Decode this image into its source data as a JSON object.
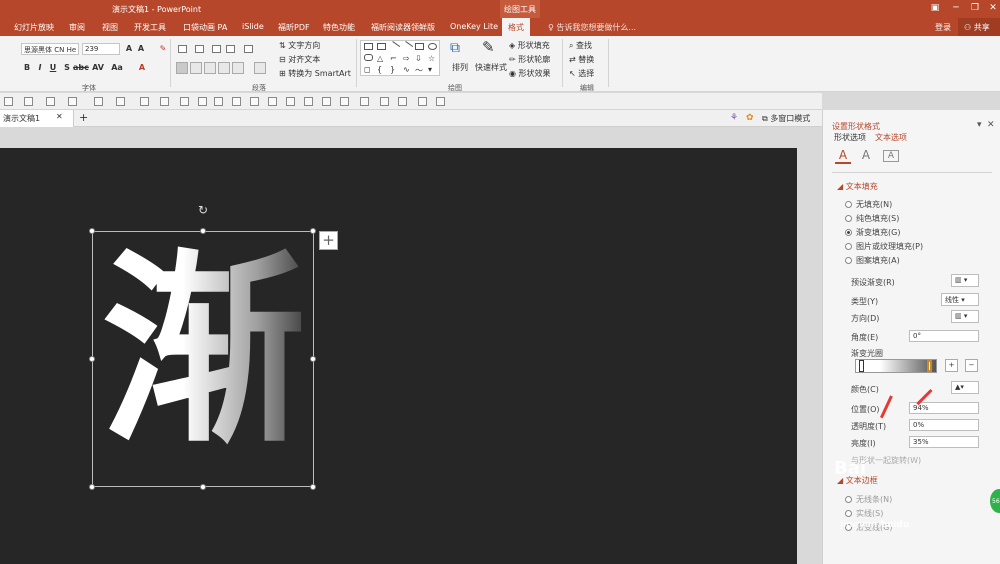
{
  "window": {
    "title": "演示文稿1 - PowerPoint",
    "context_tab": "绘图工具"
  },
  "tabs": [
    {
      "label": "幻灯片放映"
    },
    {
      "label": "审阅"
    },
    {
      "label": "视图"
    },
    {
      "label": "开发工具"
    },
    {
      "label": "口袋动画 PA"
    },
    {
      "label": "iSlide"
    },
    {
      "label": "福昕PDF"
    },
    {
      "label": "特色功能"
    },
    {
      "label": "福昕阅读器领鲜版"
    },
    {
      "label": "OneKey Lite"
    },
    {
      "label": "格式"
    }
  ],
  "tell_me": "告诉我您想要做什么...",
  "account": {
    "login": "登录",
    "share": "共享"
  },
  "ribbon": {
    "font_name": "思源黑体 CN He",
    "font_size": "239",
    "font_buttons": [
      "B",
      "I",
      "U",
      "S",
      "abc",
      "AV",
      "Aa",
      "A"
    ],
    "text_direction": "文字方向",
    "align_text": "对齐文本",
    "convert_smartart": "转换为 SmartArt",
    "group_font": "字体",
    "group_paragraph": "段落",
    "group_drawing": "绘图",
    "group_edit": "编辑",
    "arrange": "排列",
    "quick_styles": "快速样式",
    "shape_fill": "形状填充",
    "shape_outline": "形状轮廓",
    "shape_effect": "形状效果",
    "find": "查找",
    "replace": "替换",
    "select": "选择"
  },
  "doc_tab": {
    "name": "演示文稿1",
    "multi_window": "多窗口模式"
  },
  "slide": {
    "char": "渐"
  },
  "pane": {
    "title": "设置形状格式",
    "tab_shape": "形状选项",
    "tab_text": "文本选项",
    "section_fill": "文本填充",
    "fill_options": [
      "无填充(N)",
      "纯色填充(S)",
      "渐变填充(G)",
      "图片或纹理填充(P)",
      "图案填充(A)"
    ],
    "selected_fill_index": 2,
    "preset_gradient": "预设渐变(R)",
    "type_label": "类型(Y)",
    "type_value": "线性",
    "direction": "方向(D)",
    "angle_label": "角度(E)",
    "angle_value": "0°",
    "gradient_stops": "渐变光圈",
    "color": "颜色(C)",
    "position_label": "位置(O)",
    "position_value": "94%",
    "transparency_label": "透明度(T)",
    "transparency_value": "0%",
    "brightness_label": "亮度(I)",
    "brightness_value": "35%",
    "rotate_with_shape": "与形状一起旋转(W)",
    "section_outline": "文本边框",
    "outline_options": [
      "无线条(N)",
      "实线(S)",
      "渐变线(G)"
    ]
  },
  "watermark": {
    "text": "Bai",
    "text2": "jingyan.baidu"
  },
  "badge": "56"
}
